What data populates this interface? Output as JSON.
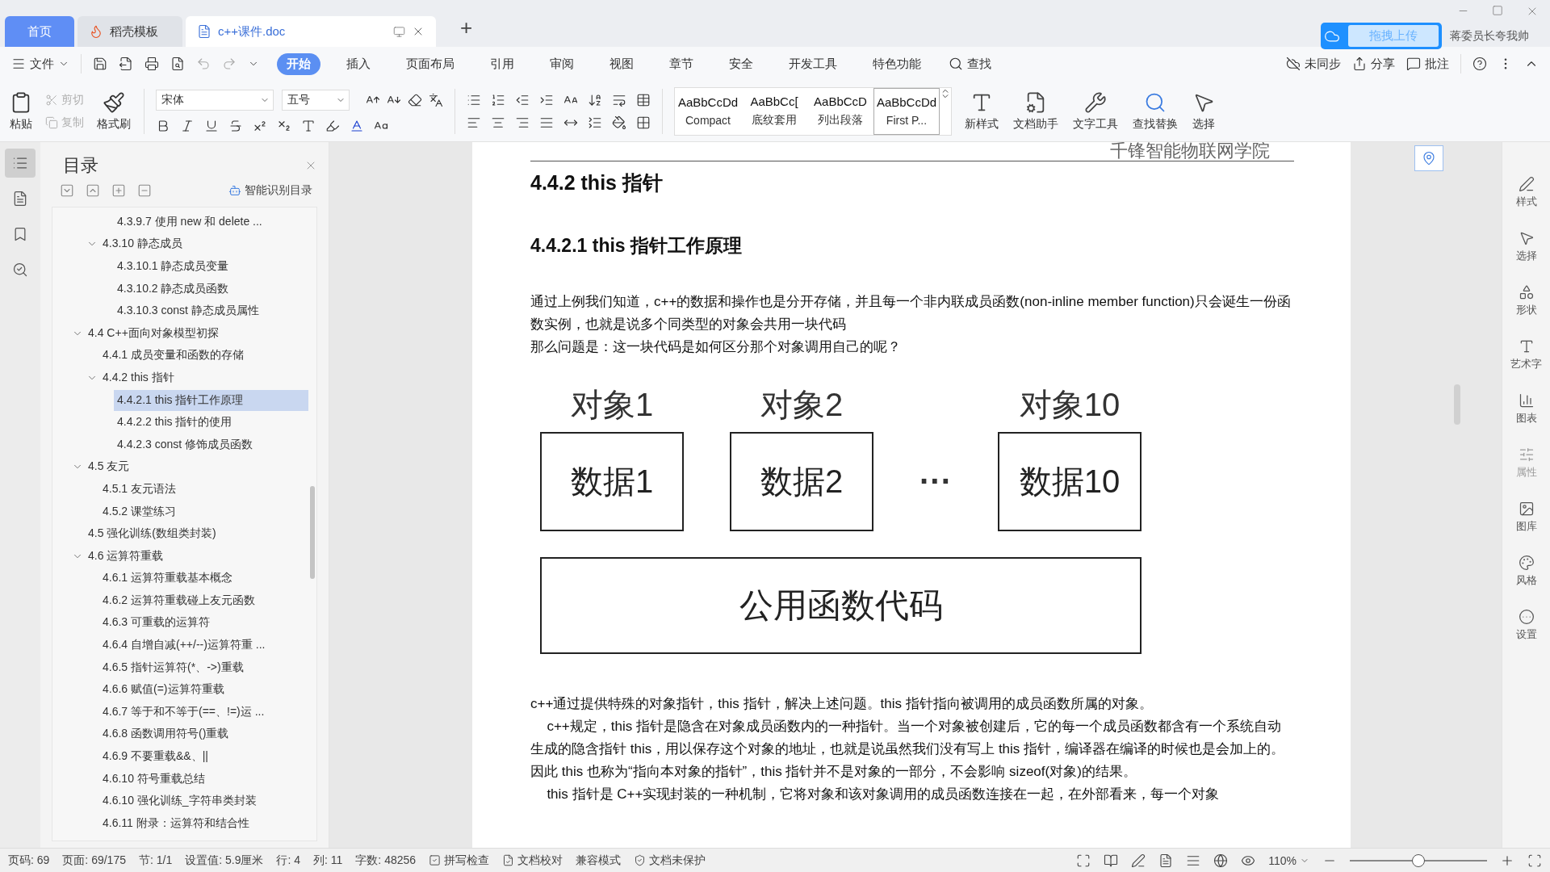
{
  "tabs": [
    {
      "label": "首页",
      "kind": "home",
      "selected": false
    },
    {
      "label": "稻壳模板",
      "kind": "template",
      "selected": false
    },
    {
      "label": "c++课件.doc",
      "kind": "doc",
      "selected": true
    }
  ],
  "new_tab": "+",
  "cloud": {
    "button": "拖拽上传",
    "user": "蒋委员长夸我帅"
  },
  "menu": {
    "file": "文件",
    "tabs": [
      {
        "label": "开始",
        "selected": true
      },
      {
        "label": "插入",
        "selected": false
      },
      {
        "label": "页面布局",
        "selected": false
      },
      {
        "label": "引用",
        "selected": false
      },
      {
        "label": "审阅",
        "selected": false
      },
      {
        "label": "视图",
        "selected": false
      },
      {
        "label": "章节",
        "selected": false
      },
      {
        "label": "安全",
        "selected": false
      },
      {
        "label": "开发工具",
        "selected": false
      },
      {
        "label": "特色功能",
        "selected": false
      }
    ],
    "search": "查找",
    "sync": "未同步",
    "share": "分享",
    "comment": "批注"
  },
  "ribbon": {
    "paste": "粘贴",
    "edit": [
      {
        "label": "剪切",
        "kind": "cut",
        "disabled": true
      },
      {
        "label": "复制",
        "kind": "copy",
        "disabled": true
      }
    ],
    "painter": "格式刷",
    "font": "宋体",
    "size": "五号",
    "styles": [
      {
        "sample": "AaBbCcDd",
        "name": "Compact",
        "selected": false
      },
      {
        "sample": "AaBbCc[",
        "name": "底纹套用",
        "selected": false
      },
      {
        "sample": "AaBbCcD",
        "name": "列出段落",
        "selected": false
      },
      {
        "sample": "AaBbCcDd",
        "name": "First P...",
        "selected": true
      }
    ],
    "tools": [
      {
        "label": "新样式",
        "kind": "style"
      },
      {
        "label": "文档助手",
        "kind": "assistant"
      },
      {
        "label": "文字工具",
        "kind": "wrench"
      },
      {
        "label": "查找替换",
        "kind": "find"
      },
      {
        "label": "选择",
        "kind": "select"
      }
    ]
  },
  "nav_rail": [
    {
      "kind": "outline",
      "selected": true
    },
    {
      "kind": "pages",
      "selected": false
    },
    {
      "kind": "bookmark",
      "selected": false
    },
    {
      "kind": "find",
      "selected": false
    }
  ],
  "toc": {
    "title": "目录",
    "smart": "智能识别目录",
    "items": [
      {
        "children": [
          {
            "children": [
              {
                "label": "4.3.9.7  使用 new 和 delete  ...",
                "selected": false
              }
            ]
          },
          {
            "label": "4.3.10  静态成员",
            "expanded": true,
            "selected": false,
            "children": [
              {
                "label": "4.3.10.1  静态成员变量",
                "selected": false
              },
              {
                "label": "4.3.10.2  静态成员函数",
                "selected": false
              },
              {
                "label": "4.3.10.3 const 静态成员属性",
                "selected": false
              }
            ]
          }
        ]
      },
      {
        "label": "4.4 C++面向对象模型初探",
        "expanded": true,
        "selected": false,
        "children": [
          {
            "label": "4.4.1  成员变量和函数的存储",
            "selected": false
          },
          {
            "label": "4.4.2 this 指针",
            "expanded": true,
            "selected": false,
            "children": [
              {
                "label": "4.4.2.1 this 指针工作原理",
                "selected": true
              },
              {
                "label": "4.4.2.2 this 指针的使用",
                "selected": false
              },
              {
                "label": "4.4.2.3 const 修饰成员函数",
                "selected": false
              }
            ]
          }
        ]
      },
      {
        "label": "4.5  友元",
        "expanded": true,
        "selected": false,
        "children": [
          {
            "label": "4.5.1  友元语法",
            "selected": false
          },
          {
            "label": "4.5.2  课堂练习",
            "selected": false
          }
        ]
      },
      {
        "label": "4.5  强化训练(数组类封装)",
        "selected": false
      },
      {
        "label": "4.6  运算符重载",
        "expanded": true,
        "selected": false,
        "children": [
          {
            "label": "4.6.1  运算符重载基本概念",
            "selected": false
          },
          {
            "label": "4.6.2  运算符重载碰上友元函数",
            "selected": false
          },
          {
            "label": "4.6.3  可重载的运算符",
            "selected": false
          },
          {
            "label": "4.6.4  自增自减(++/--)运算符重 ...",
            "selected": false
          },
          {
            "label": "4.6.5  指针运算符(*、->)重载",
            "selected": false
          },
          {
            "label": "4.6.6  赋值(=)运算符重载",
            "selected": false
          },
          {
            "label": "4.6.7  等于和不等于(==、!=)运 ...",
            "selected": false
          },
          {
            "label": "4.6.8  函数调用符号()重载",
            "selected": false
          },
          {
            "label": "4.6.9  不要重载&&、||",
            "selected": false
          },
          {
            "label": "4.6.10  符号重载总结",
            "selected": false
          },
          {
            "label": "4.6.10  强化训练_字符串类封装",
            "selected": false
          },
          {
            "label": "4.6.11  附录：运算符和结合性",
            "selected": false
          }
        ]
      }
    ]
  },
  "document": {
    "header": "千锋智能物联网学院",
    "heading": "4.4.2 this 指针",
    "subheading": "4.4.2.1 this 指针工作原理",
    "intro": [
      "通过上例我们知道，c++的数据和操作也是分开存储，并且每一个非内联成员函数(non-inline member function)只会诞生一份函数实例，也就是说多个同类型的对象会共用一块代码",
      "那么问题是：这一块代码是如何区分那个对象调用自己的呢？"
    ],
    "diagram": {
      "objects": [
        {
          "label": "对象1",
          "data": "数据1"
        },
        {
          "label": "对象2",
          "data": "数据2"
        },
        {
          "label": "对象10",
          "data": "数据10"
        }
      ],
      "ellipsis": "···",
      "shared": "公用函数代码"
    },
    "body": [
      {
        "text": "c++通过提供特殊的对象指针，this 指针，解决上述问题。this 指针指向被调用的成员函数所属的对象。",
        "indent": false
      },
      {
        "text": "c++规定，this 指针是隐含在对象成员函数内的一种指针。当一个对象被创建后，它的每一个成员函数都含有一个系统自动生成的隐含指针 this，用以保存这个对象的地址，也就是说虽然我们没有写上 this 指针，编译器在编译的时候也是会加上的。因此 this 也称为“指向本对象的指针”，this 指针并不是对象的一部分，不会影响 sizeof(对象)的结果。",
        "indent": true
      },
      {
        "text": "this 指针是 C++实现封装的一种机制，它将对象和该对象调用的成员函数连接在一起，在外部看来，每一个对象",
        "indent": true
      }
    ]
  },
  "right_panel": [
    {
      "label": "样式",
      "kind": "style",
      "disabled": false
    },
    {
      "label": "选择",
      "kind": "select",
      "disabled": false
    },
    {
      "label": "形状",
      "kind": "shape",
      "disabled": false
    },
    {
      "label": "艺术字",
      "kind": "art",
      "disabled": false
    },
    {
      "label": "图表",
      "kind": "chart",
      "disabled": false
    },
    {
      "label": "属性",
      "kind": "props",
      "disabled": true
    },
    {
      "label": "图库",
      "kind": "gallery",
      "disabled": false
    },
    {
      "label": "风格",
      "kind": "theme",
      "disabled": false
    },
    {
      "label": "设置",
      "kind": "settings",
      "disabled": false
    }
  ],
  "status_bar": {
    "fields": [
      "页码: 69",
      "页面: 69/175",
      "节: 1/1",
      "设置值: 5.9厘米",
      "行: 4",
      "列: 11",
      "字数: 48256"
    ],
    "toggles": [
      {
        "label": "拼写检查",
        "kind": "check"
      },
      {
        "label": "文档校对",
        "kind": "proof"
      },
      {
        "label": "兼容模式",
        "kind": "plain"
      },
      {
        "label": "文档未保护",
        "kind": "shield"
      }
    ],
    "zoom": {
      "reading": "110%",
      "level": 0.5
    }
  }
}
